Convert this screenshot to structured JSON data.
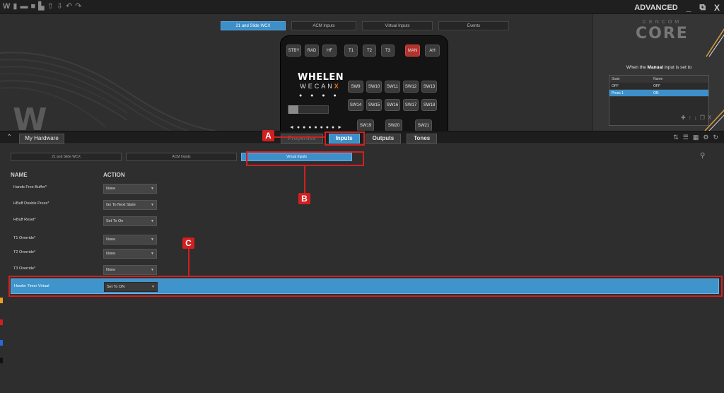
{
  "titlebar": {
    "mode": "ADVANCED",
    "icons": [
      "app-logo-icon",
      "bookmark-icon",
      "open-folder-icon",
      "save-icon",
      "print-icon",
      "upload-icon",
      "download-icon",
      "undo-icon",
      "redo-icon"
    ]
  },
  "top": {
    "device_tabs": [
      "21 and Slide WCX",
      "ACM Inputs",
      "Virtual Inputs",
      "Events"
    ],
    "controller": {
      "brand": "WHELEN",
      "sub": "WECAN",
      "sub_x": "X",
      "dots": "● ● ● ●",
      "arrows": "◄ ● ● ● ● ● ● ● ►",
      "row1": [
        "STBY",
        "RAD",
        "HF",
        "T1",
        "T2",
        "T3",
        "MAN",
        "AH"
      ],
      "row2": [
        "SW9",
        "SW10",
        "SW11",
        "SW12",
        "SW13"
      ],
      "row3": [
        "SW14",
        "SW15",
        "SW16",
        "SW17",
        "SW18"
      ],
      "row4": [
        "SW19",
        "SW20",
        "SW21"
      ]
    }
  },
  "right_panel": {
    "brand_small": "CENCOM",
    "brand_large": "CORE",
    "when_prefix": "When the",
    "when_input": "Manual",
    "when_suffix": "input is set to",
    "col_state": "State",
    "col_name": "Name",
    "rows": [
      {
        "state": "OFF",
        "name": "OFF"
      },
      {
        "state": "Press 1",
        "name": "ON"
      }
    ]
  },
  "midbar": {
    "hardware": "My Hardware",
    "tabs": [
      "Properties",
      "Inputs",
      "Outputs",
      "Tones"
    ]
  },
  "content": {
    "sub_tabs": [
      "21 and Slide WCX",
      "ACM Inputs",
      "Virtual Inputs"
    ],
    "col_name": "NAME",
    "col_action": "ACTION",
    "rows": [
      {
        "name": "Hands Free Buffer*",
        "action": "None"
      },
      {
        "name": "HBuff Double Press*",
        "action": "Go To Next State"
      },
      {
        "name": "HBuff Reset*",
        "action": "Set To On"
      },
      {
        "name": "T1 Override*",
        "action": "None"
      },
      {
        "name": "T2 Override*",
        "action": "None"
      },
      {
        "name": "T3 Override*",
        "action": "None"
      },
      {
        "name": "Howler Timer Virtual",
        "action": "Set To ON"
      }
    ]
  },
  "annotations": [
    "A",
    "B",
    "C"
  ],
  "colors": {
    "accent": "#3c8fc9",
    "annotation": "#d21f1f",
    "man_button": "#b3322c"
  }
}
